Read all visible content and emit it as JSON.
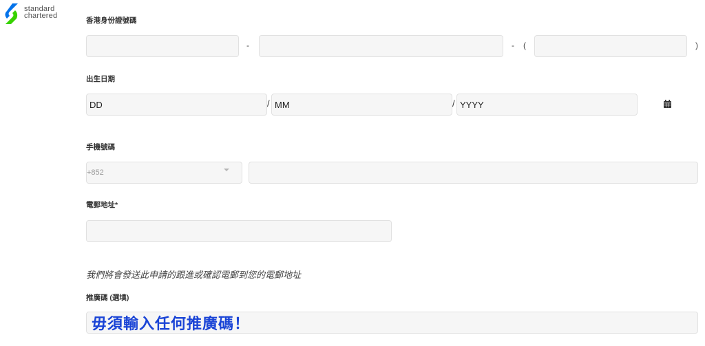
{
  "logo": {
    "line1": "standard",
    "line2": "chartered",
    "icon": "standard-chartered-logo-icon",
    "brand_blue": "#0473ea",
    "brand_green": "#38d200"
  },
  "form": {
    "hkid": {
      "label": "香港身份證號碼",
      "dash1": "-",
      "dash2": "-",
      "open_paren": "(",
      "close_paren": ")"
    },
    "dob": {
      "label": "出生日期",
      "day_placeholder": "DD",
      "month_placeholder": "MM",
      "year_placeholder": "YYYY",
      "slash": "/",
      "icon": "calendar-icon"
    },
    "mobile": {
      "label": "手機號碼",
      "country_code": "+852",
      "dropdown_icon": "chevron-down-icon"
    },
    "email": {
      "label": "電郵地址*",
      "notice": "我們將會發送此申請的跟進或確認電郵到您的電郵地址"
    },
    "promo": {
      "label": "推廣碼 (選填)",
      "value": "毋須輸入任何推廣碼！",
      "value_color": "#1a44d6"
    }
  }
}
